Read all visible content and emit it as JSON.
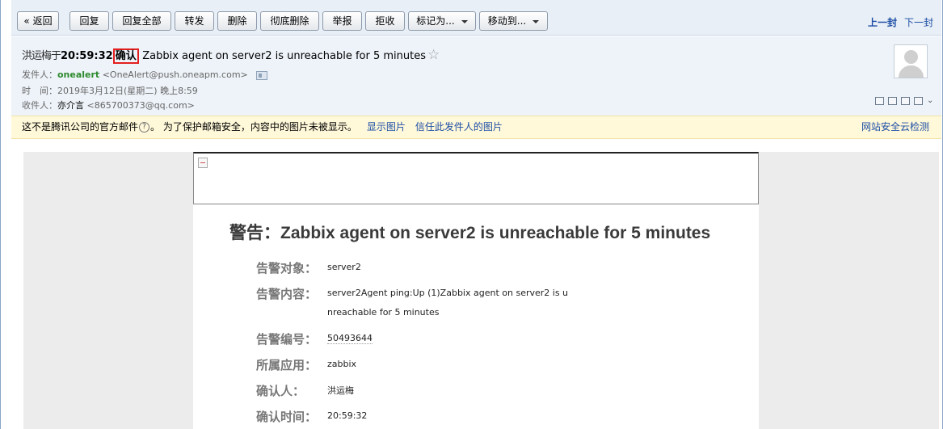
{
  "toolbar": {
    "back_label": "« 返回",
    "reply_label": "回复",
    "reply_all_label": "回复全部",
    "forward_label": "转发",
    "delete_label": "删除",
    "perm_delete_label": "彻底删除",
    "report_label": "举报",
    "reject_label": "拒收",
    "mark_as_label": "标记为...",
    "move_to_label": "移动到...",
    "prev_label": "上一封",
    "next_label": "下一封"
  },
  "header": {
    "subject_blur": "洪运梅于",
    "subject_time": "20:59:32",
    "subject_confirm": "确认",
    "subject_text": "Zabbix agent on server2 is unreachable for 5 minutes",
    "from_label": "发件人：",
    "from_name": "onealert",
    "from_addr": "<OneAlert@push.oneapm.com>",
    "time_label": "时　间：",
    "time_value": "2019年3月12日(星期二) 晚上8:59",
    "to_label": "收件人：",
    "to_name": "亦介言",
    "to_addr": "<865700373@qq.com>"
  },
  "notice": {
    "text_before": "这不是腾讯公司的官方邮件",
    "text_after": "。 为了保护邮箱安全，内容中的图片未被显示。",
    "show_images": "显示图片",
    "trust_sender": "信任此发件人的图片",
    "security_check": "网站安全云检测"
  },
  "mail": {
    "title": "警告：Zabbix agent on server2 is unreachable for 5 minutes",
    "rows": [
      {
        "label": "告警对象：",
        "value": "server2"
      },
      {
        "label": "告警内容：",
        "value": "server2Agent ping:Up (1)Zabbix agent on server2 is u",
        "value2": "nreachable for 5 minutes"
      },
      {
        "label": "告警编号：",
        "value": "50493644"
      },
      {
        "label": "所属应用：",
        "value": "zabbix"
      },
      {
        "label": "确认人：",
        "value": "洪运梅"
      },
      {
        "label": "确认时间：",
        "value": "20:59:32"
      }
    ]
  }
}
